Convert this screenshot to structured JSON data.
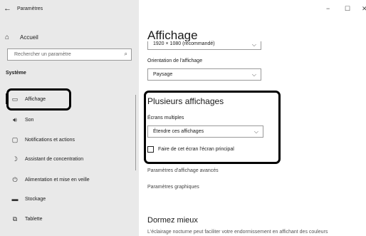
{
  "titlebar": {
    "back_icon": "←",
    "title": "Paramètres",
    "minimize_icon": "−",
    "maximize_icon": "☐",
    "close_icon": "✕"
  },
  "sidebar": {
    "home": {
      "icon": "⌂",
      "label": "Accueil"
    },
    "search": {
      "placeholder": "Rechercher un paramètre",
      "icon": "⌕"
    },
    "section_heading": "Système",
    "items": [
      {
        "icon": "▭",
        "label": "Affichage",
        "selected": true
      },
      {
        "icon": "🔊︎",
        "label": "Son"
      },
      {
        "icon": "▢",
        "label": "Notifications et actions"
      },
      {
        "icon": "☽",
        "label": "Assistant de concentration"
      },
      {
        "icon": "⏻",
        "label": "Alimentation et mise en veille"
      },
      {
        "icon": "▬",
        "label": "Stockage"
      },
      {
        "icon": "⧉",
        "label": "Tablette"
      }
    ]
  },
  "main": {
    "page_title": "Affichage",
    "resolution_select": {
      "value": "1920 × 1080 (recommandé)",
      "chevron": "⌵"
    },
    "orientation": {
      "label": "Orientation de l'affichage",
      "value": "Paysage",
      "chevron": "⌵"
    },
    "multi_display": {
      "heading": "Plusieurs affichages",
      "screens_label": "Écrans multiples",
      "screens_value": "Étendre ces affichages",
      "chevron": "⌵",
      "checkbox_label": "Faire de cet écran l'écran principal",
      "checkbox_checked": false
    },
    "links": [
      "Paramètres d'affichage avancés",
      "Paramètres graphiques"
    ],
    "sleep_heading": "Dormez mieux",
    "sleep_desc": "L'éclairage nocturne peut faciliter votre endormissement en affichant des couleurs"
  },
  "colors": {
    "sidebar_bg": "#e9e9e9",
    "content_bg": "#ffffff",
    "highlight_border": "#000000"
  }
}
